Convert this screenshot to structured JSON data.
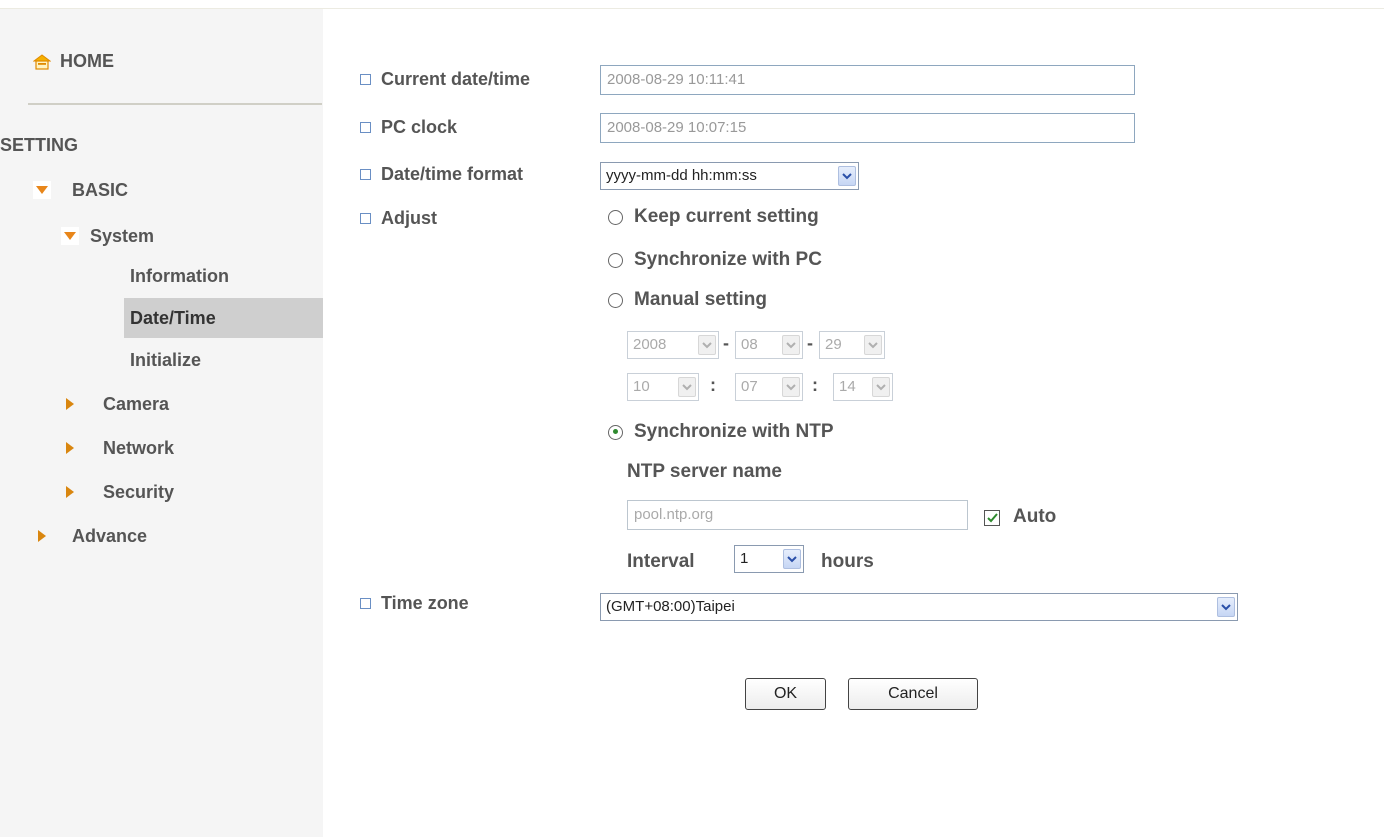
{
  "sidebar": {
    "home_label": "HOME",
    "setting_label": "SETTING",
    "basic_label": "BASIC",
    "system_label": "System",
    "system_items": [
      "Information",
      "Date/Time",
      "Initialize"
    ],
    "selected_item": "Date/Time",
    "basic_subsections": [
      "Camera",
      "Network",
      "Security"
    ],
    "advance_label": "Advance"
  },
  "form": {
    "current_datetime": {
      "label": "Current date/time",
      "value": "2008-08-29   10:11:41"
    },
    "pc_clock": {
      "label": "PC clock",
      "value": "2008-08-29   10:07:15"
    },
    "datetime_format": {
      "label": "Date/time format",
      "value": "yyyy-mm-dd hh:mm:ss"
    },
    "adjust": {
      "label": "Adjust",
      "options": [
        "Keep current setting",
        "Synchronize with PC",
        "Manual setting",
        "Synchronize with NTP"
      ],
      "selected": "Synchronize with NTP",
      "manual": {
        "year": "2008",
        "month": "08",
        "day": "29",
        "hour": "10",
        "minute": "07",
        "second": "14",
        "date_sep": "-",
        "time_sep": ":"
      },
      "ntp": {
        "server_label": "NTP server name",
        "server_value": "pool.ntp.org",
        "auto_label": "Auto",
        "auto_checked": true,
        "interval_label": "Interval",
        "interval_value": "1",
        "interval_unit": "hours"
      }
    },
    "time_zone": {
      "label": "Time zone",
      "value": "(GMT+08:00)Taipei"
    }
  },
  "buttons": {
    "ok": "OK",
    "cancel": "Cancel"
  },
  "colors": {
    "sidebar_bg": "#f5f5f5",
    "selected_bg": "#cfcfcf",
    "bullet_square": "#6a8fc4",
    "expand_arrow": "#e8861a",
    "collapsed_arrow": "#d9860f",
    "home_icon": "#f0a000"
  },
  "icons": {
    "home": "home-icon",
    "expanded": "triangle-down-icon",
    "collapsed": "triangle-right-icon",
    "bullet": "square-bullet-icon",
    "dropdown": "chevron-down-icon"
  }
}
